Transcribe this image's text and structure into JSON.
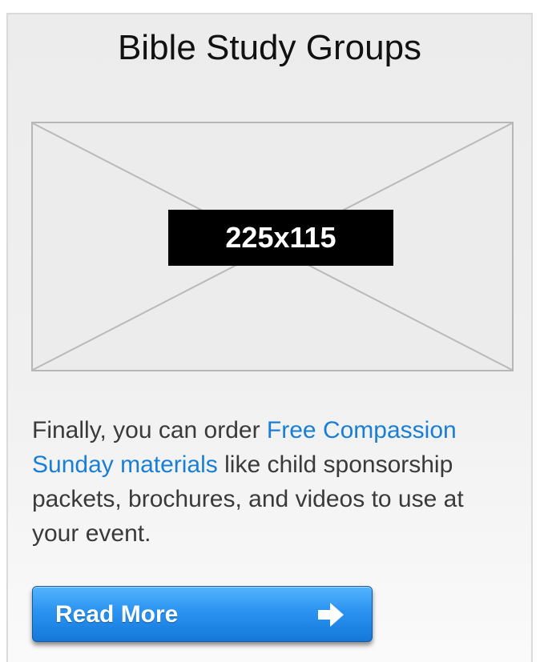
{
  "card": {
    "title": "Bible Study Groups",
    "image_placeholder": {
      "label": "225x115"
    },
    "body": {
      "before_link": "Finally, you can order ",
      "link_text": "Free Compassion Sunday materials",
      "after_link": " like child sponsorship packets, brochures, and videos to use at your event."
    },
    "button": {
      "label": "Read More",
      "icon": "arrow-right-icon"
    }
  },
  "colors": {
    "link": "#1a7fd4",
    "button_top": "#55b3ff",
    "button_bottom": "#1478d9",
    "card_background": "#ececec"
  }
}
